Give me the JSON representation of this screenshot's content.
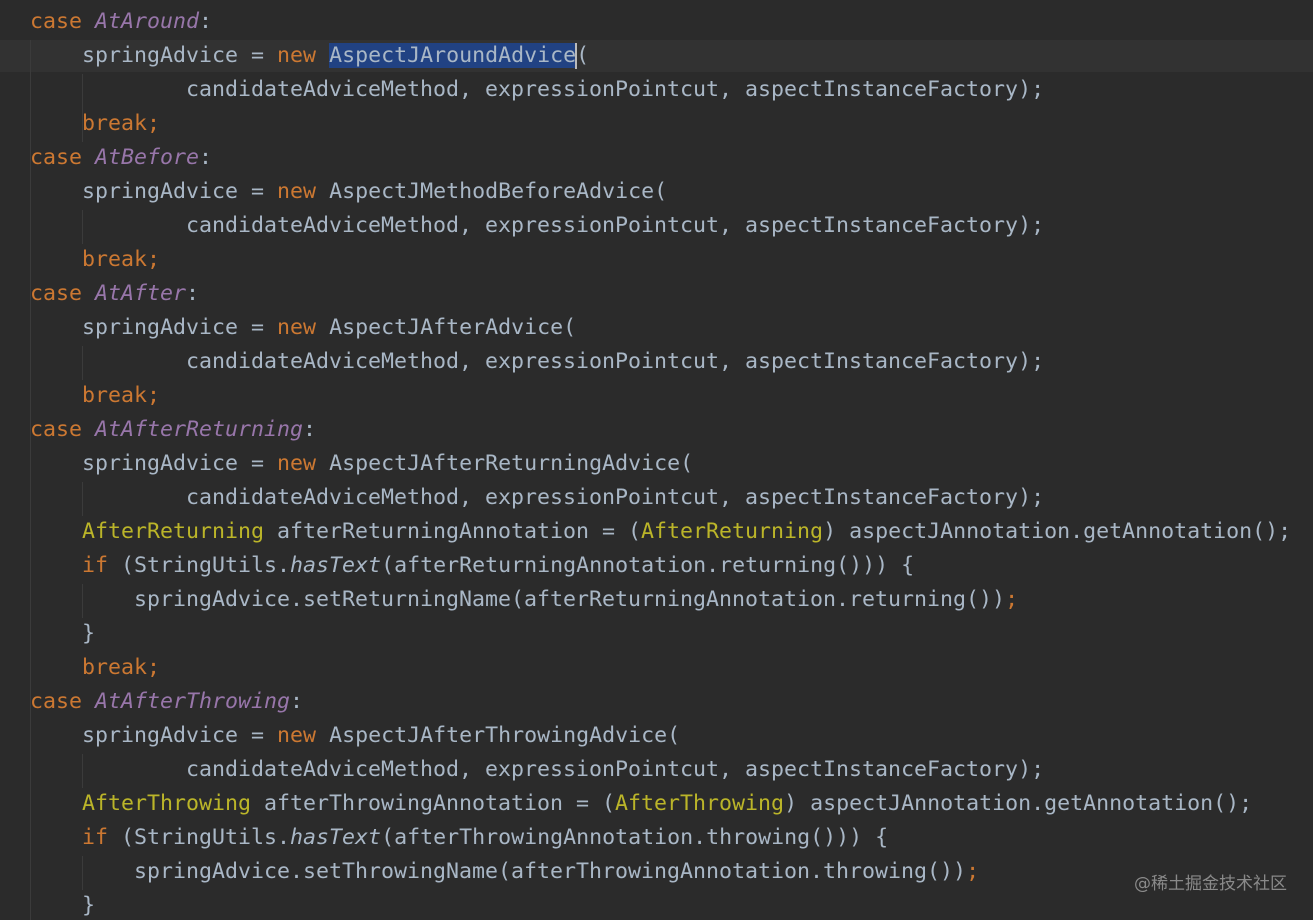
{
  "editor": {
    "watermark": "@稀土掘金技术社区",
    "keywords": {
      "case": "case",
      "new": "new",
      "break": "break",
      "if": "if"
    },
    "text": {
      "spring_advice_eq": "springAdvice = ",
      "args": "candidateAdviceMethod, expressionPointcut, aspectInstanceFactory",
      "args_close": ");",
      "open_paren": "(",
      "colon": ":",
      "semicolon": ";",
      "space": " ",
      "close_brace": "}",
      "if_open": " (StringUtils.",
      "has_text": "hasText",
      "brace_open": " {"
    },
    "cases": {
      "around": {
        "label": "AtAround",
        "class_name": "AspectJAroundAdvice"
      },
      "before": {
        "label": "AtBefore",
        "class_name": "AspectJMethodBeforeAdvice"
      },
      "after": {
        "label": "AtAfter",
        "class_name": "AspectJAfterAdvice"
      },
      "after_returning": {
        "label": "AtAfterReturning",
        "class_name": "AspectJAfterReturningAdvice",
        "annotation_type": "AfterReturning",
        "var_decl": " afterReturningAnnotation = (",
        "cast_rest": ") aspectJAnnotation.getAnnotation();",
        "if_args": "(afterReturningAnnotation.returning()))",
        "setter_call": "springAdvice.setReturningName(afterReturningAnnotation.returning())"
      },
      "after_throwing": {
        "label": "AtAfterThrowing",
        "class_name": "AspectJAfterThrowingAdvice",
        "annotation_type": "AfterThrowing",
        "var_decl": " afterThrowingAnnotation = (",
        "cast_rest": ") aspectJAnnotation.getAnnotation();",
        "if_args": "(afterThrowingAnnotation.throwing()))",
        "setter_call": "springAdvice.setThrowingName(afterThrowingAnnotation.throwing())"
      }
    }
  }
}
